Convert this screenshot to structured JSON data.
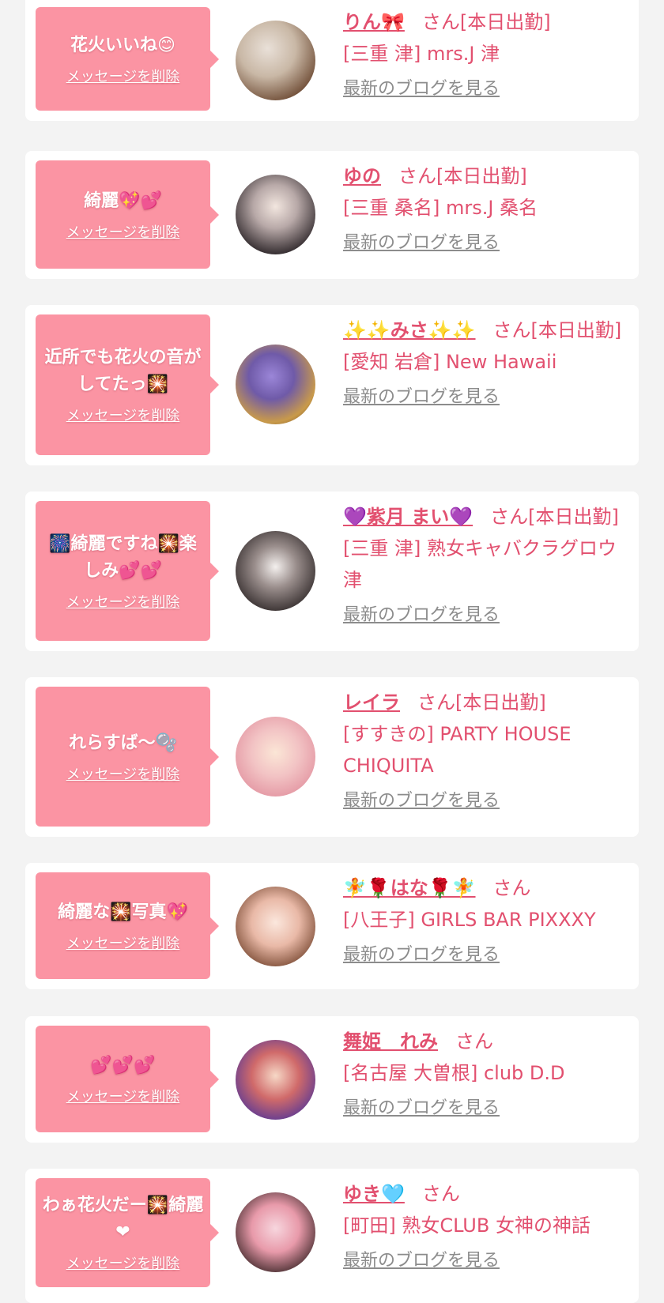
{
  "colors": {
    "accent": "#e2506f",
    "bubble": "#fb94a3",
    "muted": "#8c8c8c",
    "bg": "#f3f3f3"
  },
  "delete_label": "メッセージを削除",
  "blog_label": "最新のブログを見る",
  "items": [
    {
      "message": "花火いいね😊",
      "name": "りん🎀",
      "san": "さん[本日出勤]",
      "shop": "[三重 津] mrs.J 津"
    },
    {
      "message": "綺麗💖💕",
      "name": "ゆの",
      "san": "さん[本日出勤]",
      "shop": "[三重 桑名] mrs.J 桑名"
    },
    {
      "message": "近所でも花火の音がしてたっ🎇",
      "name": "✨✨みさ✨✨",
      "san": "さん[本日出勤]",
      "shop": "[愛知 岩倉] New Hawaii"
    },
    {
      "message": "🎆綺麗ですね🎇楽しみ💕💕",
      "name": "💜紫月 まい💜",
      "san": "さん[本日出勤]",
      "shop": "[三重 津] 熟女キャバクラグロウ津"
    },
    {
      "message": "れらすば〜🫧",
      "name": "レイラ",
      "san": "さん[本日出勤]",
      "shop": "[すすきの] PARTY HOUSE CHIQUITA"
    },
    {
      "message": "綺麗な🎇写真💖",
      "name": "🧚🌹はな🌹🧚",
      "san": "さん",
      "shop": "[八王子] GIRLS BAR PIXXXY"
    },
    {
      "message": "💕💕💕",
      "name": "舞姫　れみ",
      "san": "さん",
      "shop": "[名古屋 大曽根] club D.D"
    },
    {
      "message": "わぁ花火だー🎇綺麗❤",
      "name": "ゆき🩵",
      "san": "さん",
      "shop": "[町田] 熟女CLUB 女神の神話"
    }
  ]
}
